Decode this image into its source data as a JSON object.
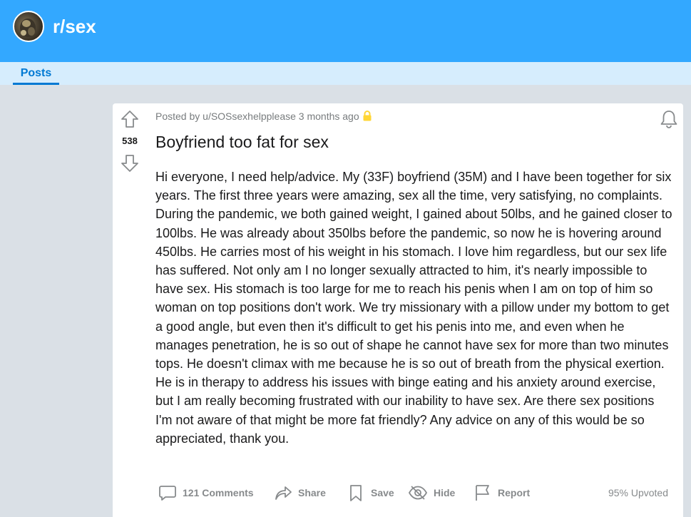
{
  "header": {
    "subreddit": "r/sex",
    "avatar_icon": "subreddit-avatar-icon",
    "banner_color": "#33a8ff"
  },
  "tabs": [
    {
      "label": "Posts",
      "active": true
    }
  ],
  "post": {
    "score": "538",
    "meta": "Posted by u/SOSsexhelpplease 3 months ago",
    "locked": true,
    "title": "Boyfriend too fat for sex",
    "body": "Hi everyone, I need help/advice. My (33F) boyfriend (35M) and I have been together for six years. The first three years were amazing, sex all the time, very satisfying, no complaints. During the pandemic, we both gained weight, I gained about 50lbs, and he gained closer to 100lbs. He was already about 350lbs before the pandemic, so now he is hovering around 450lbs. He carries most of his weight in his stomach. I love him regardless, but our sex life has suffered. Not only am I no longer sexually attracted to him, it's nearly impossible to have sex. His stomach is too large for me to reach his penis when I am on top of him so woman on top positions don't work. We try missionary with a pillow under my bottom to get a good angle, but even then it's difficult to get his penis into me, and even when he manages penetration, he is so out of shape he cannot have sex for more than two minutes tops. He doesn't climax with me because he is so out of breath from the physical exertion. He is in therapy to address his issues with binge eating and his anxiety around exercise, but I am really becoming frustrated with our inability to have sex. Are there sex positions I'm not aware of that might be more fat friendly? Any advice on any of this would be so appreciated, thank you.",
    "actions": {
      "comments": "121 Comments",
      "share": "Share",
      "save": "Save",
      "hide": "Hide",
      "report": "Report"
    },
    "upvoted": "95% Upvoted"
  },
  "icons": {
    "upvote": "upvote-arrow-icon",
    "downvote": "downvote-arrow-icon",
    "lock": "lock-icon",
    "bell": "bell-icon",
    "comments": "comment-bubble-icon",
    "share": "share-arrow-icon",
    "save": "bookmark-icon",
    "hide": "eye-slash-icon",
    "report": "flag-icon"
  },
  "colors": {
    "accent": "#0079d3",
    "page_bg": "#dae0e6",
    "tab_bar": "#d6edfd",
    "lock": "#ffd635"
  }
}
